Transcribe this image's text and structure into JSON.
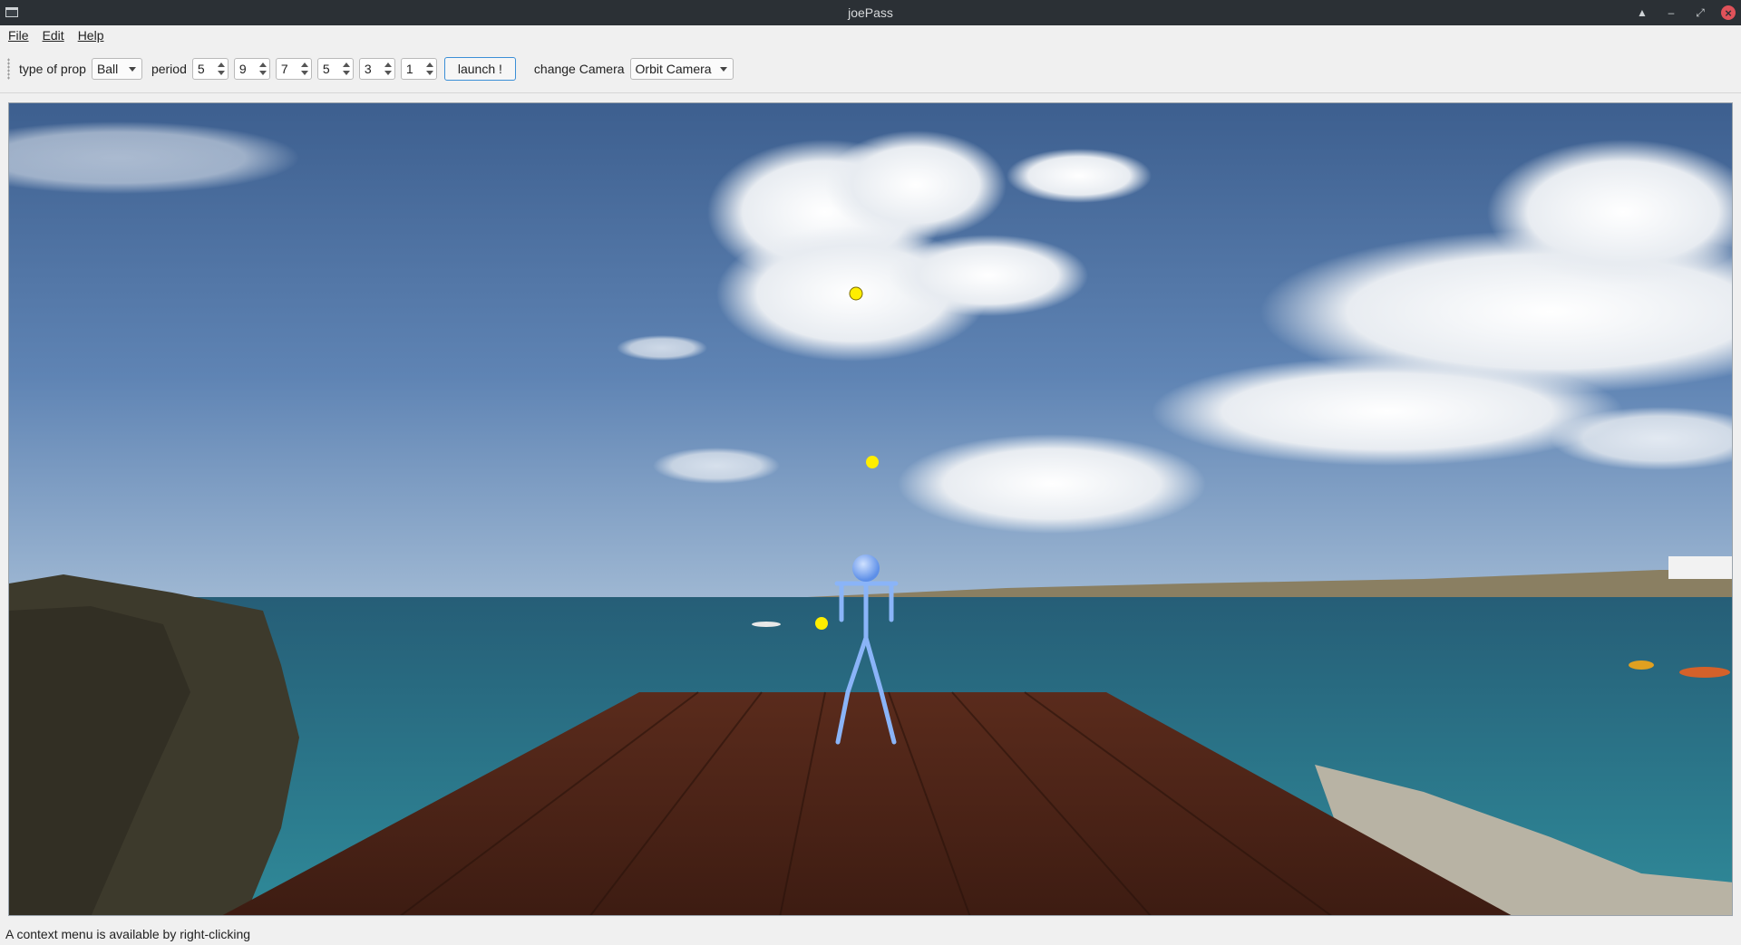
{
  "window": {
    "title": "joePass"
  },
  "menu": {
    "items": [
      {
        "label": "File"
      },
      {
        "label": "Edit"
      },
      {
        "label": "Help"
      }
    ]
  },
  "toolbar": {
    "prop_label": "type of prop",
    "prop_value": "Ball",
    "period_label": "period",
    "period_values": [
      "5",
      "9",
      "7",
      "5",
      "3",
      "1"
    ],
    "launch_label": "launch !",
    "camera_label": "change Camera",
    "camera_value": "Orbit Camera"
  },
  "scene": {
    "ball_color": "#ffee00",
    "juggler_color": "#8ab4f8",
    "deck_color": "#5a2e1e",
    "sky_color": "#4a6c99",
    "sea_color": "#2f7f8f"
  },
  "status": {
    "text": "A context menu is available by right-clicking"
  }
}
